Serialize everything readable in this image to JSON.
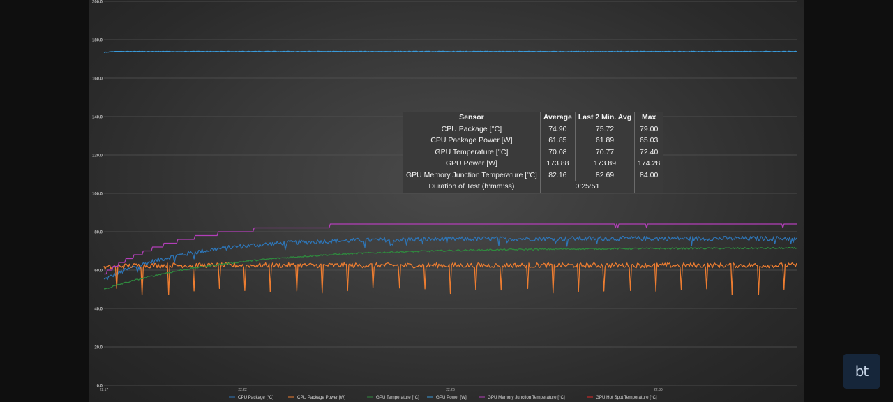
{
  "chart_data": {
    "type": "line",
    "title": "",
    "xlabel": "",
    "ylabel": "",
    "ylim": [
      0,
      200
    ],
    "yticks": [
      "0.0",
      "20.0",
      "40.0",
      "60.0",
      "80.0",
      "100.0",
      "120.0",
      "140.0",
      "160.0",
      "180.0",
      "200.0"
    ],
    "xticks": [
      {
        "t": 0,
        "label": "22:17"
      },
      {
        "t": 0.2,
        "label": "22:22"
      },
      {
        "t": 0.5,
        "label": "22:26"
      },
      {
        "t": 0.8,
        "label": "22:30"
      }
    ],
    "grid": true,
    "legend_position": "bottom",
    "series": [
      {
        "name": "CPU Package [°C]",
        "color": "#2e75b6",
        "profile": "rise",
        "start": 55,
        "end": 76.5,
        "tau": 0.12,
        "noise": 1.2,
        "dips": 0,
        "spikes": 0
      },
      {
        "name": "CPU Package Power [W]",
        "color": "#ed7d31",
        "profile": "flat",
        "start": 61,
        "end": 62.5,
        "tau": 0.02,
        "noise": 1.3,
        "dips": 27,
        "dip_low": 47,
        "spikes": 0
      },
      {
        "name": "GPU Temperature [°C]",
        "color": "#2f8a3e",
        "profile": "rise",
        "start": 50,
        "end": 71.5,
        "tau": 0.18,
        "noise": 0.4,
        "dips": 0,
        "spikes": 0
      },
      {
        "name": "GPU Power [W]",
        "color": "#3a9ad9",
        "profile": "flat",
        "start": 173.5,
        "end": 173.9,
        "tau": 0.01,
        "noise": 0.15,
        "dips": 0,
        "spikes": 0
      },
      {
        "name": "GPU Memory Junction Temperature [°C]",
        "color": "#b23fb8",
        "profile": "step",
        "start": 58,
        "end": 84,
        "tau": 0.1,
        "noise": 0,
        "dips": 0,
        "spikes": 0
      },
      {
        "name": "GPU Hot Spot Temperature [°C]",
        "color": "#e02828",
        "profile": "none",
        "start": 0,
        "end": 0,
        "tau": 0,
        "noise": 0,
        "dips": 0,
        "spikes": 0
      }
    ]
  },
  "table": {
    "headers": [
      "Sensor",
      "Average",
      "Last 2 Min. Avg",
      "Max"
    ],
    "rows": [
      {
        "sensor": "CPU Package [°C]",
        "avg": "74.90",
        "last2": "75.72",
        "max": "79.00"
      },
      {
        "sensor": "CPU Package Power [W]",
        "avg": "61.85",
        "last2": "61.89",
        "max": "65.03"
      },
      {
        "sensor": "GPU Temperature [°C]",
        "avg": "70.08",
        "last2": "70.77",
        "max": "72.40"
      },
      {
        "sensor": "GPU Power [W]",
        "avg": "173.88",
        "last2": "173.89",
        "max": "174.28"
      },
      {
        "sensor": "GPU Memory Junction Temperature [°C]",
        "avg": "82.16",
        "last2": "82.69",
        "max": "84.00"
      }
    ],
    "duration_label": "Duration of Test (h:mm:ss)",
    "duration_value": "0:25:51"
  },
  "logo": {
    "text": "bt",
    "bg": "#16263a"
  }
}
